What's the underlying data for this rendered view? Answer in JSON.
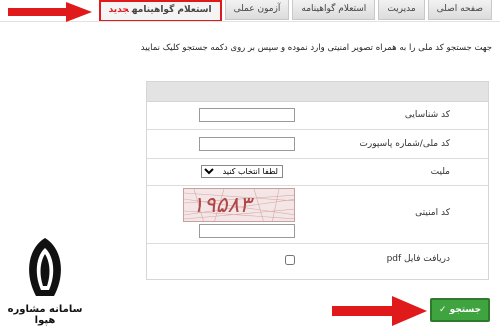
{
  "tabs": [
    {
      "label": "صفحه اصلی"
    },
    {
      "label": "مدیریت"
    },
    {
      "label": "استعلام گواهینامه"
    },
    {
      "label": "آزمون عملی"
    },
    {
      "label": "استعلام گواهینامه",
      "badge": "جدید"
    }
  ],
  "instruction": "جهت جستجو کد ملی را به همراه تصویر امنیتی وارد نموده و سپس بر روی دکمه جستجو کلیک نمایید",
  "form": {
    "fields": [
      {
        "label": "کد شناسایی",
        "value": ""
      },
      {
        "label": "کد ملی/شماره پاسپورت",
        "value": ""
      },
      {
        "label": "ملیت",
        "selected": "لطفا انتخاب کنید"
      },
      {
        "label": "کد امنیتی",
        "captcha_text": "۱۹۵۸۳",
        "value": ""
      },
      {
        "label": "دریافت فایل pdf",
        "checked": false
      }
    ]
  },
  "submit_label": "جستجو ✓",
  "logo_text": "سامانه مشاوره هپوا",
  "colors": {
    "accent_red": "#e01a1a",
    "submit_green": "#3fa33f",
    "header_gray": "#e3e3e3"
  }
}
